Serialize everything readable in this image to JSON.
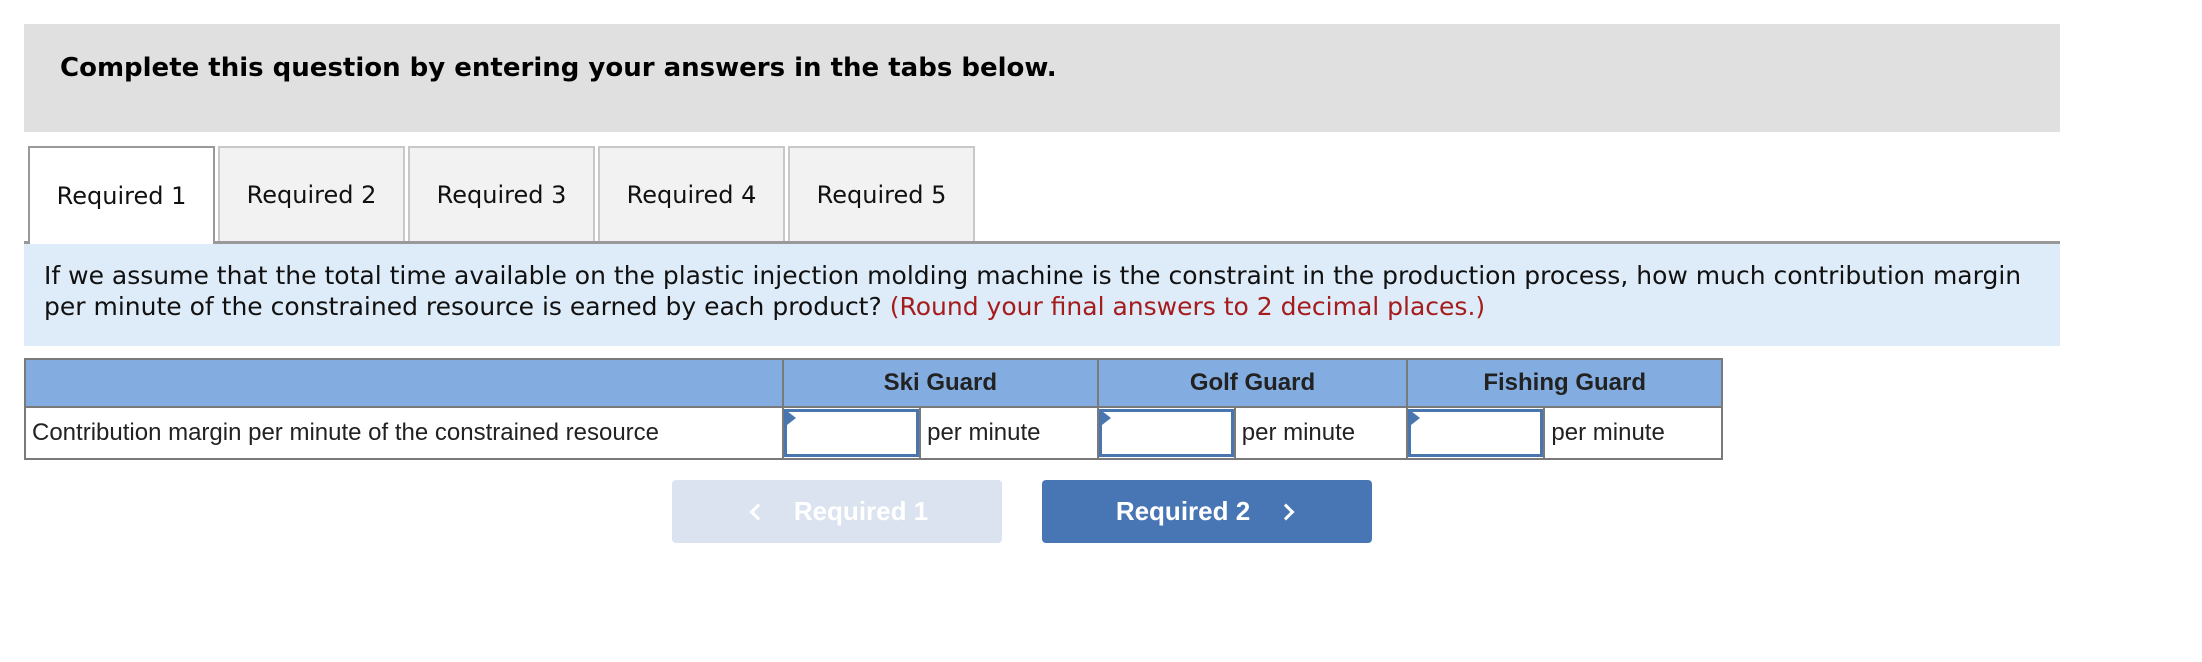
{
  "instruction": {
    "text": "Complete this question by entering your answers in the tabs below."
  },
  "tabs": [
    {
      "label": "Required 1",
      "active": true
    },
    {
      "label": "Required 2",
      "active": false
    },
    {
      "label": "Required 3",
      "active": false
    },
    {
      "label": "Required 4",
      "active": false
    },
    {
      "label": "Required 5",
      "active": false
    }
  ],
  "prompt": {
    "question": "If we assume that the total time available on the plastic injection molding machine is the constraint in the production process, how much contribution margin per minute of the constrained resource is earned by each product?",
    "note": "(Round your final answers to 2 decimal places.)"
  },
  "table": {
    "corner_header": "",
    "columns": [
      "Ski Guard",
      "Golf Guard",
      "Fishing Guard"
    ],
    "rows": [
      {
        "label": "Contribution margin per minute of the constrained resource",
        "cells": [
          {
            "value": "",
            "unit": "per minute"
          },
          {
            "value": "",
            "unit": "per minute"
          },
          {
            "value": "",
            "unit": "per minute"
          }
        ]
      }
    ]
  },
  "navigation": {
    "prev_label": "Required 1",
    "prev_enabled": false,
    "next_label": "Required 2",
    "next_enabled": true
  },
  "colors": {
    "instruction_bg": "#e0e0e0",
    "prompt_bg": "#deebf8",
    "note_red": "#a51c1c",
    "table_header_bg": "#83ace0",
    "input_border": "#4a76b0",
    "next_button_bg": "#4876b4",
    "prev_button_bg": "#dae3ef"
  }
}
